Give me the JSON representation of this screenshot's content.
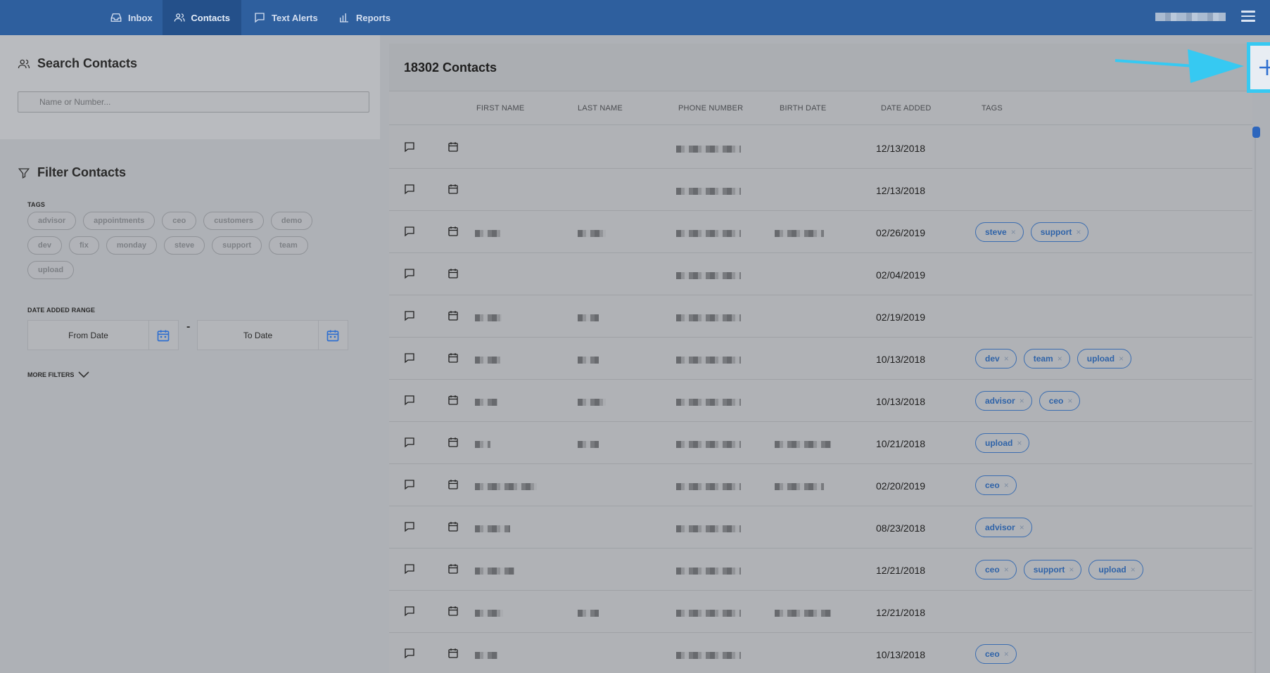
{
  "nav": {
    "items": [
      {
        "label": "Inbox",
        "icon": "inbox-icon"
      },
      {
        "label": "Contacts",
        "icon": "contacts-icon",
        "active": true
      },
      {
        "label": "Text Alerts",
        "icon": "chat-bubble-icon"
      },
      {
        "label": "Reports",
        "icon": "bar-chart-icon"
      }
    ]
  },
  "search": {
    "title": "Search Contacts",
    "placeholder": "Name or Number..."
  },
  "filter": {
    "title": "Filter Contacts",
    "tags_label": "TAGS",
    "tags": [
      "advisor",
      "appointments",
      "ceo",
      "customers",
      "demo",
      "dev",
      "fix",
      "monday",
      "steve",
      "support",
      "team",
      "upload"
    ],
    "date_range_label": "DATE ADDED RANGE",
    "from_placeholder": "From Date",
    "to_placeholder": "To Date",
    "date_separator": "-",
    "more_filters": "MORE FILTERS"
  },
  "contacts": {
    "title": "18302 Contacts",
    "add_icon": "plus-icon",
    "columns": [
      "FIRST NAME",
      "LAST NAME",
      "PHONE NUMBER",
      "BIRTH DATE",
      "DATE ADDED",
      "TAGS"
    ],
    "rows": [
      {
        "date_added": "12/13/2018",
        "tags": []
      },
      {
        "date_added": "12/13/2018",
        "tags": []
      },
      {
        "date_added": "02/26/2019",
        "tags": [
          "steve",
          "support"
        ]
      },
      {
        "date_added": "02/04/2019",
        "tags": []
      },
      {
        "date_added": "02/19/2019",
        "tags": []
      },
      {
        "date_added": "10/13/2018",
        "tags": [
          "dev",
          "team",
          "upload"
        ]
      },
      {
        "date_added": "10/13/2018",
        "tags": [
          "advisor",
          "ceo"
        ]
      },
      {
        "date_added": "10/21/2018",
        "tags": [
          "upload"
        ]
      },
      {
        "date_added": "02/20/2019",
        "tags": [
          "ceo"
        ]
      },
      {
        "date_added": "08/23/2018",
        "tags": [
          "advisor"
        ]
      },
      {
        "date_added": "12/21/2018",
        "tags": [
          "ceo",
          "support",
          "upload"
        ]
      },
      {
        "date_added": "12/21/2018",
        "tags": []
      },
      {
        "date_added": "10/13/2018",
        "tags": [
          "ceo"
        ]
      }
    ]
  },
  "colors": {
    "topbar": "#2e5f9e",
    "accent": "#2f63a8",
    "highlight": "#36c9f2"
  }
}
